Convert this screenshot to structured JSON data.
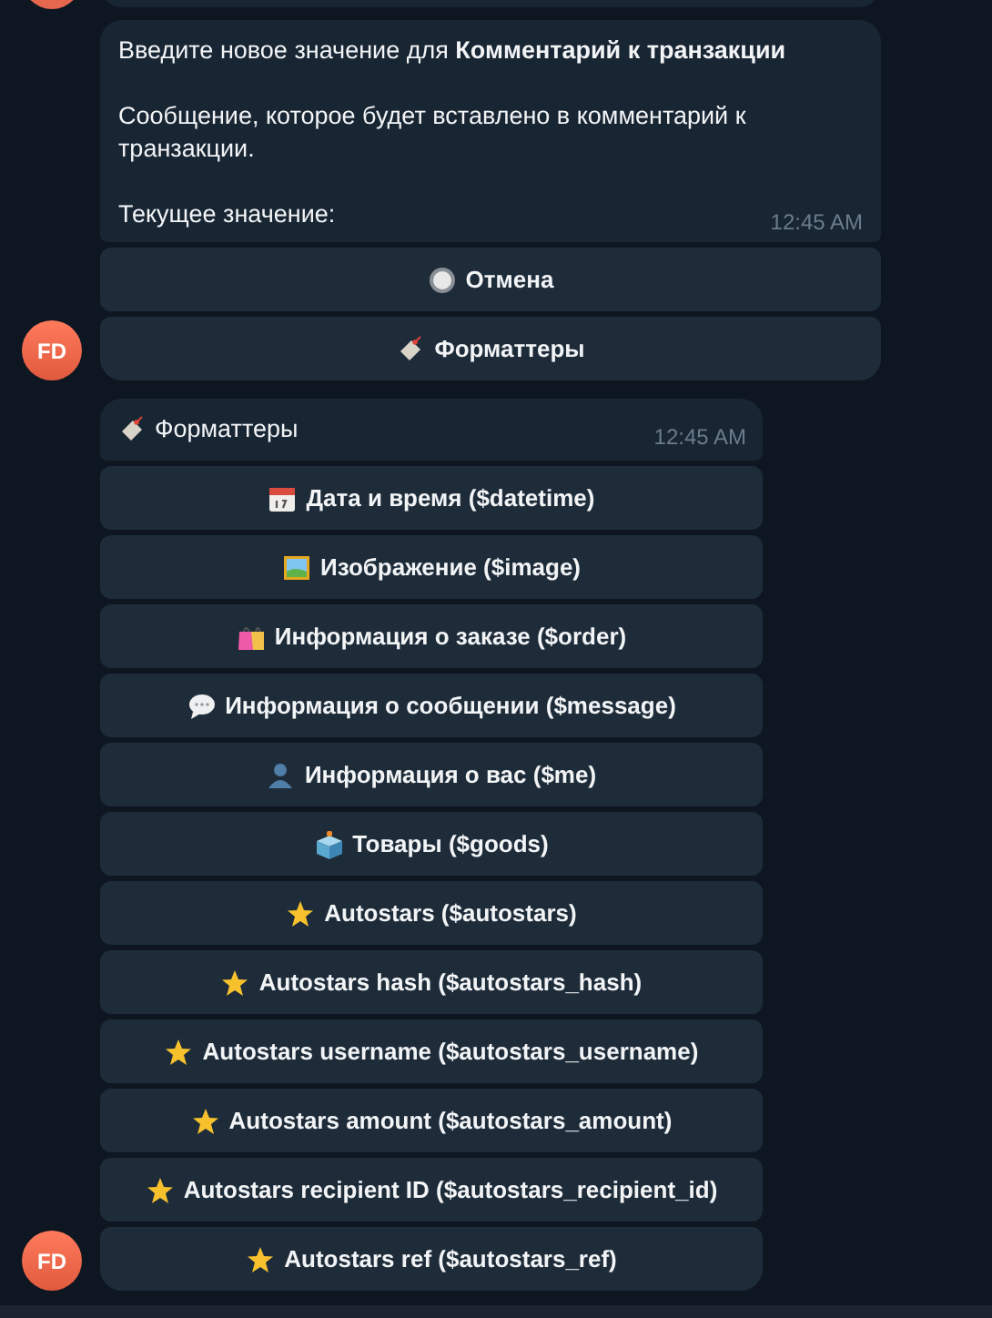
{
  "messages": [
    {
      "avatar": "FD",
      "paragraphs": [
        "Введите новое значение для **Комментарий к транзакции**",
        "Сообщение, которое будет вставлено в комментарий к транзакции.",
        "Текущее значение:"
      ],
      "time": "12:45 AM",
      "buttons": [
        {
          "kind": "radio",
          "label": "Отмена"
        },
        {
          "kind": "tag",
          "label": "Форматтеры"
        }
      ]
    },
    {
      "avatar": "FD",
      "header": {
        "kind": "tag",
        "text": "Форматтеры"
      },
      "time": "12:45 AM",
      "buttons": [
        {
          "kind": "calendar",
          "label": "Дата и время ($datetime)"
        },
        {
          "kind": "image",
          "label": "Изображение ($image)"
        },
        {
          "kind": "bag",
          "label": "Информация о заказе ($order)"
        },
        {
          "kind": "speech",
          "label": "Информация о сообщении ($message)"
        },
        {
          "kind": "person",
          "label": "Информация о вас ($me)"
        },
        {
          "kind": "box",
          "label": "Товары ($goods)"
        },
        {
          "kind": "star",
          "label": "Autostars ($autostars)"
        },
        {
          "kind": "star",
          "label": "Autostars hash ($autostars_hash)"
        },
        {
          "kind": "star",
          "label": "Autostars username ($autostars_username)"
        },
        {
          "kind": "star",
          "label": "Autostars amount ($autostars_amount)"
        },
        {
          "kind": "star",
          "label": "Autostars recipient ID ($autostars_recipient_id)"
        },
        {
          "kind": "star",
          "label": "Autostars ref ($autostars_ref)"
        }
      ]
    }
  ]
}
